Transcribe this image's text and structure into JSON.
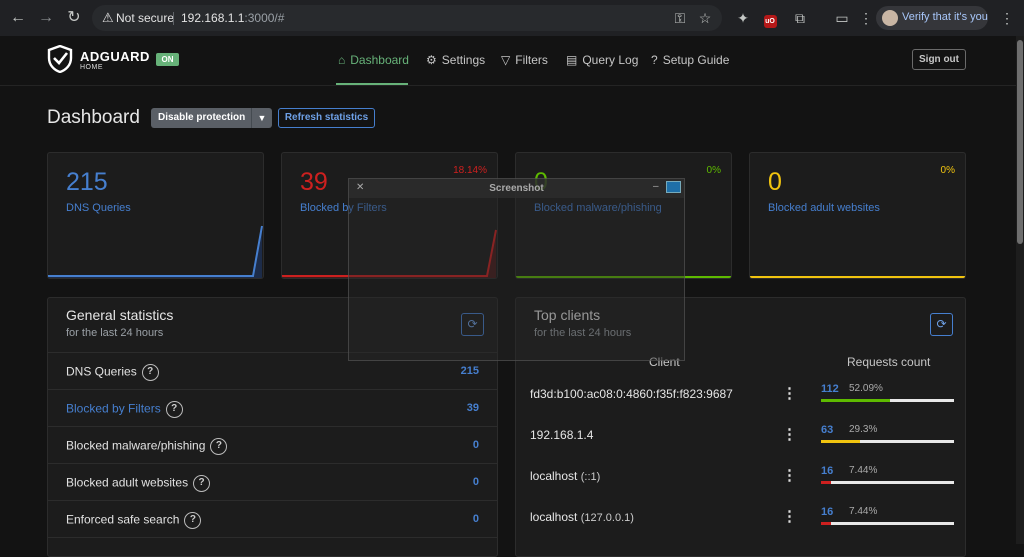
{
  "browser": {
    "not_secure": "Not secure",
    "url_host": "192.168.1.1",
    "url_path": ":3000/#",
    "verify": "Verify that it's you"
  },
  "app": {
    "brand": "ADGUARD",
    "brand_sub": "HOME",
    "on_badge": "ON",
    "nav": {
      "dashboard": "Dashboard",
      "settings": "Settings",
      "filters": "Filters",
      "query_log": "Query Log",
      "setup_guide": "Setup Guide"
    },
    "sign_out": "Sign out",
    "accent": "#67b279"
  },
  "page": {
    "title": "Dashboard",
    "disable_protection": "Disable protection",
    "refresh_statistics": "Refresh statistics"
  },
  "cards": [
    {
      "value": "215",
      "label": "DNS Queries",
      "percent": "",
      "color": "#467fcf"
    },
    {
      "value": "39",
      "label": "Blocked by Filters",
      "percent": "18.14%",
      "color": "#cd201f"
    },
    {
      "value": "0",
      "label": "Blocked malware/phishing",
      "percent": "0%",
      "color": "#5eba00"
    },
    {
      "value": "0",
      "label": "Blocked adult websites",
      "percent": "0%",
      "color": "#f1c40f"
    }
  ],
  "general": {
    "title": "General statistics",
    "subtitle": "for the last 24 hours",
    "rows": [
      {
        "label": "DNS Queries",
        "value": "215"
      },
      {
        "label": "Blocked by Filters",
        "value": "39"
      },
      {
        "label": "Blocked malware/phishing",
        "value": "0"
      },
      {
        "label": "Blocked adult websites",
        "value": "0"
      },
      {
        "label": "Enforced safe search",
        "value": "0"
      }
    ]
  },
  "clients": {
    "title": "Top clients",
    "subtitle": "for the last 24 hours",
    "col_client": "Client",
    "col_requests": "Requests count",
    "rows": [
      {
        "name": "fd3d:b100:ac08:0:4860:f35f:f823:9687",
        "sub": "",
        "count": "112",
        "percent": "52.09%",
        "fill": 0.5209,
        "color": "#5eba00"
      },
      {
        "name": "192.168.1.4",
        "sub": "",
        "count": "63",
        "percent": "29.3%",
        "fill": 0.293,
        "color": "#f1c40f"
      },
      {
        "name": "localhost",
        "sub": "(::1)",
        "count": "16",
        "percent": "7.44%",
        "fill": 0.0744,
        "color": "#cd201f"
      },
      {
        "name": "localhost",
        "sub": "(127.0.0.1)",
        "count": "16",
        "percent": "7.44%",
        "fill": 0.0744,
        "color": "#cd201f"
      }
    ]
  },
  "overlay": {
    "title": "Screenshot"
  }
}
